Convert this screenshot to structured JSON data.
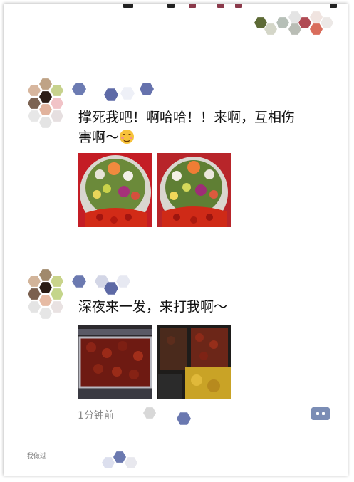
{
  "posts": [
    {
      "text_line1": "撑死我吧！啊哈哈！！来啊，互相伤",
      "text_line2": "害啊～",
      "emoji": "smiling-face-emoji",
      "photos": [
        "crawfish-platter-photo",
        "crawfish-platter-photo"
      ]
    },
    {
      "text_line1": "深夜来一发，来打我啊～",
      "photos": [
        "crawfish-tray-photo",
        "crawfish-buffet-photo"
      ],
      "time": "1分钟前"
    }
  ],
  "footer": {
    "partial_text": "我做过"
  },
  "colors": {
    "comment_button": "#7b8db5",
    "time_text": "#8a8a8a"
  }
}
